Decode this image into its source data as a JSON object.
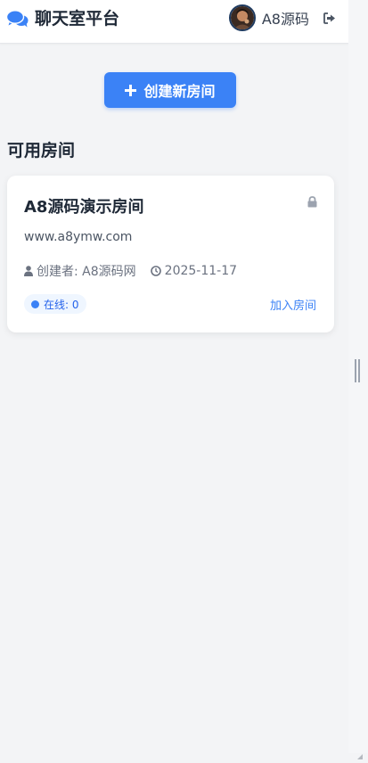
{
  "header": {
    "brand_title": "聊天室平台",
    "brand_icon": "comments-icon",
    "user_name": "A8源码",
    "logout_icon": "logout-icon"
  },
  "actions": {
    "create_room_label": "创建新房间",
    "create_room_icon": "plus-icon"
  },
  "rooms_section": {
    "title": "可用房间",
    "rooms": [
      {
        "name": "A8源码演示房间",
        "description": "www.a8ymw.com",
        "creator_label": "创建者: A8源码网",
        "date": "2025-11-17",
        "online_label": "在线: 0",
        "join_label": "加入房间",
        "locked": true
      }
    ]
  },
  "colors": {
    "accent": "#3b82f6",
    "background": "#f3f4f6",
    "text_dark": "#1f2937",
    "text_muted": "#6b7280"
  }
}
